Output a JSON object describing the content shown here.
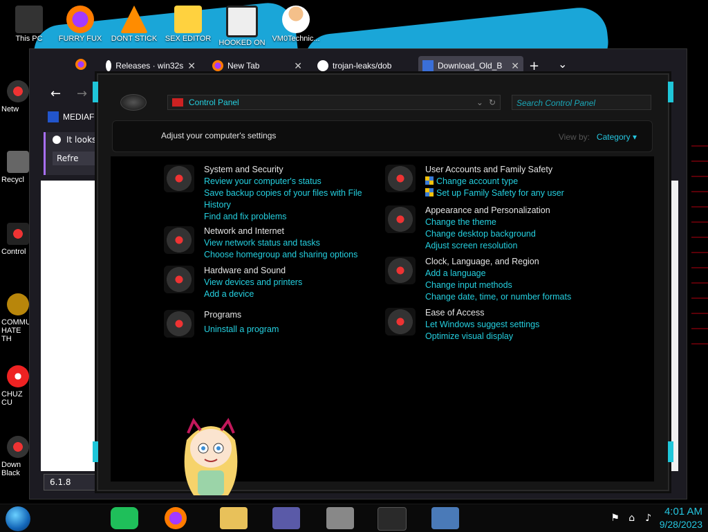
{
  "desktop": {
    "top_icons": [
      {
        "label": "This PC"
      },
      {
        "label": "FURRY FUX"
      },
      {
        "label": "DONT STICK"
      },
      {
        "label": "SEX EDITOR"
      },
      {
        "label": "HOOKED ON"
      },
      {
        "label": "VM0Technic..."
      }
    ],
    "left_icons": [
      {
        "label": "Netw"
      },
      {
        "label": "Recycl"
      },
      {
        "label": "Control"
      },
      {
        "label": "COMMU HATE TH"
      },
      {
        "label": "CHUZ CU"
      },
      {
        "label": "Down Black"
      }
    ]
  },
  "firefox": {
    "tabs": [
      {
        "label": "Releases · win32s"
      },
      {
        "label": "New Tab"
      },
      {
        "label": "trojan-leaks/dob"
      },
      {
        "label": "Download_Old_B"
      }
    ],
    "new_tab_symbol": "+",
    "list_tabs_symbol": "⌄",
    "back_symbol": "←",
    "forward_symbol": "→",
    "site_label": "MEDIAFII",
    "notice_text": "It looks",
    "refresh_label": "Refre",
    "find_value": "6.1.8",
    "close_symbol": "✕"
  },
  "control_panel": {
    "address": "Control Panel",
    "search_placeholder": "Search Control Panel",
    "header_title": "Adjust your computer's settings",
    "view_by_label": "View by:",
    "view_by_value": "Category",
    "left_categories": [
      {
        "title": "System and Security",
        "links": [
          "Review your computer's status",
          "Save backup copies of your files with File History",
          "Find and fix problems"
        ]
      },
      {
        "title": "Network and Internet",
        "links": [
          "View network status and tasks",
          "Choose homegroup and sharing options"
        ]
      },
      {
        "title": "Hardware and Sound",
        "links": [
          "View devices and printers",
          "Add a device"
        ]
      },
      {
        "title": "Programs",
        "links": [
          "Uninstall a program"
        ]
      }
    ],
    "right_categories": [
      {
        "title": "User Accounts and Family Safety",
        "links": [
          "Change account type",
          "Set up Family Safety for any user"
        ]
      },
      {
        "title": "Appearance and Personalization",
        "links": [
          "Change the theme",
          "Change desktop background",
          "Adjust screen resolution"
        ]
      },
      {
        "title": "Clock, Language, and Region",
        "links": [
          "Add a language",
          "Change input methods",
          "Change date, time, or number formats"
        ]
      },
      {
        "title": "Ease of Access",
        "links": [
          "Let Windows suggest settings",
          "Optimize visual display"
        ]
      }
    ]
  },
  "taskbar": {
    "time": "4:01 AM",
    "date": "9/28/2023"
  },
  "colors": {
    "accent_cyan": "#25d0e0",
    "link": "#25d0e0",
    "frame": "#161616",
    "desktop_blue": "#1aa6d8"
  }
}
